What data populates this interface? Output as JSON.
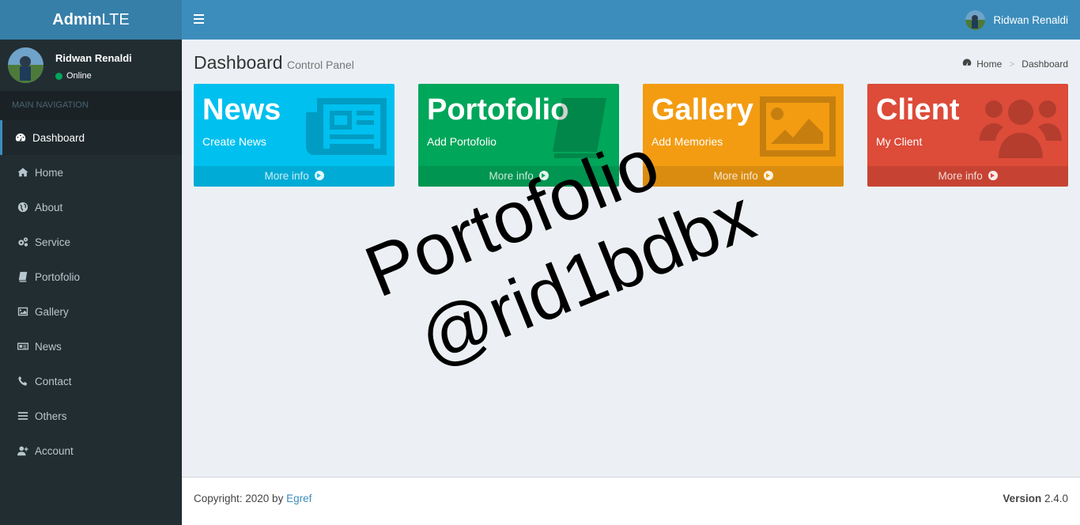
{
  "app": {
    "logo_bold": "Admin",
    "logo_rest": "LTE"
  },
  "sidebar": {
    "user_name": "Ridwan Renaldi",
    "user_status": "Online",
    "nav_header": "MAIN NAVIGATION",
    "items": [
      {
        "label": "Dashboard",
        "icon": "dashboard-icon"
      },
      {
        "label": "Home",
        "icon": "home-icon"
      },
      {
        "label": "About",
        "icon": "globe-icon"
      },
      {
        "label": "Service",
        "icon": "cogs-icon"
      },
      {
        "label": "Portofolio",
        "icon": "book-icon"
      },
      {
        "label": "Gallery",
        "icon": "image-icon"
      },
      {
        "label": "News",
        "icon": "newspaper-icon"
      },
      {
        "label": "Contact",
        "icon": "phone-icon"
      },
      {
        "label": "Others",
        "icon": "bars-icon"
      },
      {
        "label": "Account",
        "icon": "user-plus-icon"
      }
    ]
  },
  "header": {
    "user_name": "Ridwan Renaldi"
  },
  "content": {
    "title": "Dashboard",
    "subtitle": "Control Panel",
    "breadcrumb": [
      "Home",
      "Dashboard"
    ]
  },
  "boxes": [
    {
      "title": "News",
      "sub": "Create News",
      "footer": "More info",
      "color": "#00c0ef",
      "icon": "newspaper-icon"
    },
    {
      "title": "Portofolio",
      "sub": "Add Portofolio",
      "footer": "More info",
      "color": "#00a65a",
      "icon": "book-icon"
    },
    {
      "title": "Gallery",
      "sub": "Add Memories",
      "footer": "More info",
      "color": "#f39c12",
      "icon": "image-icon"
    },
    {
      "title": "Client",
      "sub": "My Client",
      "footer": "More info",
      "color": "#dd4b39",
      "icon": "users-icon"
    }
  ],
  "watermark": {
    "line1": "Portofolio",
    "line2": "@rid1bdbx"
  },
  "footer": {
    "copyright_prefix": "Copyright: 2020 by",
    "author": "Egref",
    "version_label": "Version",
    "version": "2.4.0"
  }
}
